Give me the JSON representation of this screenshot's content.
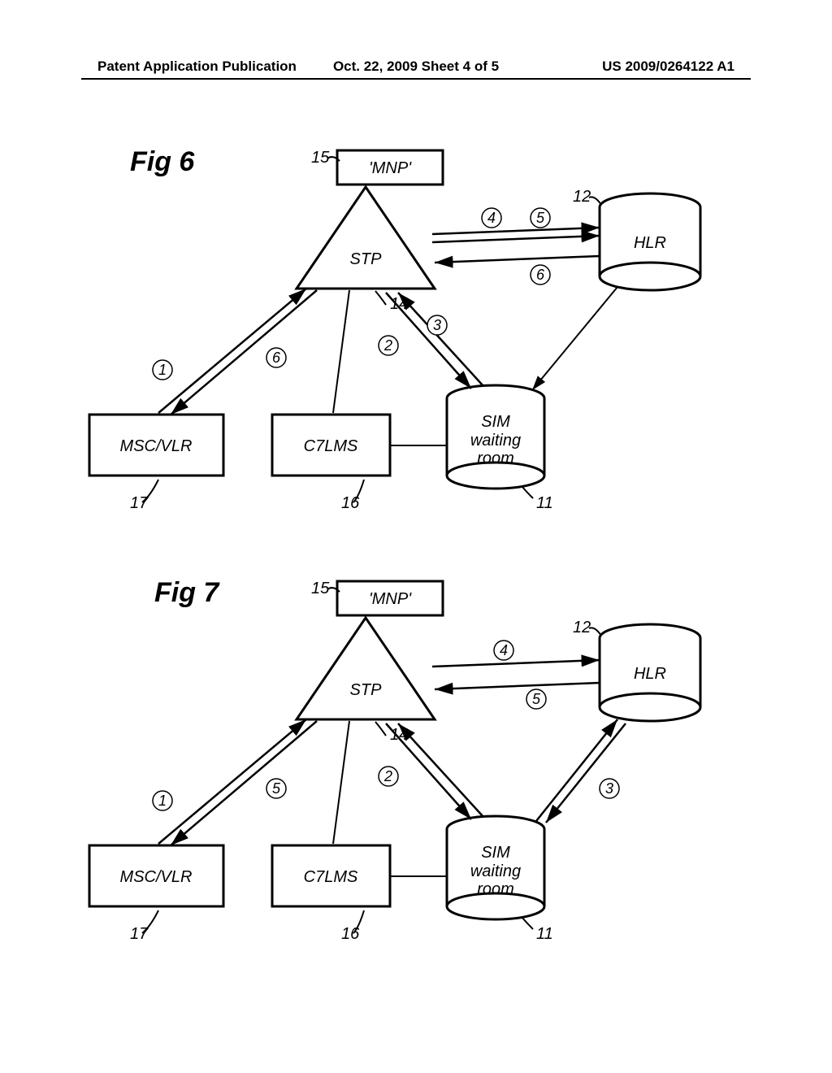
{
  "header": {
    "left": "Patent Application Publication",
    "center": "Oct. 22, 2009  Sheet 4 of 5",
    "right": "US 2009/0264122 A1"
  },
  "fig6": {
    "title": "Fig 6",
    "nodes": {
      "mnp": "'MNP'",
      "stp": "STP",
      "hlr": "HLR",
      "sim": "SIM\nwaiting\nroom",
      "msc": "MSC/VLR",
      "c7": "C7LMS"
    },
    "refs": {
      "mnp": "15",
      "stp": "14",
      "hlr": "12",
      "sim": "11",
      "c7": "16",
      "msc": "17"
    },
    "steps": [
      "1",
      "2",
      "3",
      "4",
      "5",
      "6"
    ]
  },
  "fig7": {
    "title": "Fig 7",
    "nodes": {
      "mnp": "'MNP'",
      "stp": "STP",
      "hlr": "HLR",
      "sim": "SIM\nwaiting\nroom",
      "msc": "MSC/VLR",
      "c7": "C7LMS"
    },
    "refs": {
      "mnp": "15",
      "stp": "14",
      "hlr": "12",
      "sim": "11",
      "c7": "16",
      "msc": "17"
    },
    "steps": [
      "1",
      "2",
      "3",
      "4",
      "5"
    ]
  }
}
